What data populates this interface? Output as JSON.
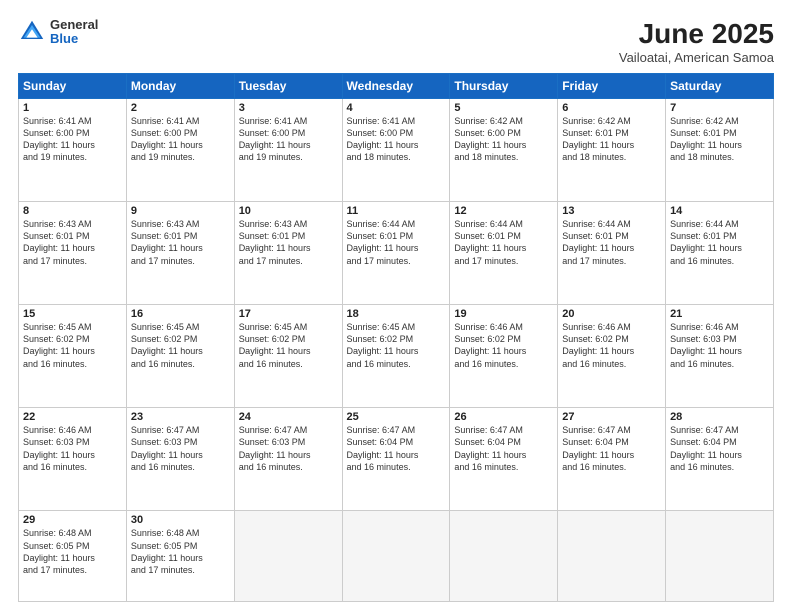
{
  "header": {
    "logo_general": "General",
    "logo_blue": "Blue",
    "month_title": "June 2025",
    "location": "Vailoatai, American Samoa"
  },
  "days_of_week": [
    "Sunday",
    "Monday",
    "Tuesday",
    "Wednesday",
    "Thursday",
    "Friday",
    "Saturday"
  ],
  "weeks": [
    [
      {
        "num": "1",
        "info": "Sunrise: 6:41 AM\nSunset: 6:00 PM\nDaylight: 11 hours\nand 19 minutes."
      },
      {
        "num": "2",
        "info": "Sunrise: 6:41 AM\nSunset: 6:00 PM\nDaylight: 11 hours\nand 19 minutes."
      },
      {
        "num": "3",
        "info": "Sunrise: 6:41 AM\nSunset: 6:00 PM\nDaylight: 11 hours\nand 19 minutes."
      },
      {
        "num": "4",
        "info": "Sunrise: 6:41 AM\nSunset: 6:00 PM\nDaylight: 11 hours\nand 18 minutes."
      },
      {
        "num": "5",
        "info": "Sunrise: 6:42 AM\nSunset: 6:00 PM\nDaylight: 11 hours\nand 18 minutes."
      },
      {
        "num": "6",
        "info": "Sunrise: 6:42 AM\nSunset: 6:01 PM\nDaylight: 11 hours\nand 18 minutes."
      },
      {
        "num": "7",
        "info": "Sunrise: 6:42 AM\nSunset: 6:01 PM\nDaylight: 11 hours\nand 18 minutes."
      }
    ],
    [
      {
        "num": "8",
        "info": "Sunrise: 6:43 AM\nSunset: 6:01 PM\nDaylight: 11 hours\nand 17 minutes."
      },
      {
        "num": "9",
        "info": "Sunrise: 6:43 AM\nSunset: 6:01 PM\nDaylight: 11 hours\nand 17 minutes."
      },
      {
        "num": "10",
        "info": "Sunrise: 6:43 AM\nSunset: 6:01 PM\nDaylight: 11 hours\nand 17 minutes."
      },
      {
        "num": "11",
        "info": "Sunrise: 6:44 AM\nSunset: 6:01 PM\nDaylight: 11 hours\nand 17 minutes."
      },
      {
        "num": "12",
        "info": "Sunrise: 6:44 AM\nSunset: 6:01 PM\nDaylight: 11 hours\nand 17 minutes."
      },
      {
        "num": "13",
        "info": "Sunrise: 6:44 AM\nSunset: 6:01 PM\nDaylight: 11 hours\nand 17 minutes."
      },
      {
        "num": "14",
        "info": "Sunrise: 6:44 AM\nSunset: 6:01 PM\nDaylight: 11 hours\nand 16 minutes."
      }
    ],
    [
      {
        "num": "15",
        "info": "Sunrise: 6:45 AM\nSunset: 6:02 PM\nDaylight: 11 hours\nand 16 minutes."
      },
      {
        "num": "16",
        "info": "Sunrise: 6:45 AM\nSunset: 6:02 PM\nDaylight: 11 hours\nand 16 minutes."
      },
      {
        "num": "17",
        "info": "Sunrise: 6:45 AM\nSunset: 6:02 PM\nDaylight: 11 hours\nand 16 minutes."
      },
      {
        "num": "18",
        "info": "Sunrise: 6:45 AM\nSunset: 6:02 PM\nDaylight: 11 hours\nand 16 minutes."
      },
      {
        "num": "19",
        "info": "Sunrise: 6:46 AM\nSunset: 6:02 PM\nDaylight: 11 hours\nand 16 minutes."
      },
      {
        "num": "20",
        "info": "Sunrise: 6:46 AM\nSunset: 6:02 PM\nDaylight: 11 hours\nand 16 minutes."
      },
      {
        "num": "21",
        "info": "Sunrise: 6:46 AM\nSunset: 6:03 PM\nDaylight: 11 hours\nand 16 minutes."
      }
    ],
    [
      {
        "num": "22",
        "info": "Sunrise: 6:46 AM\nSunset: 6:03 PM\nDaylight: 11 hours\nand 16 minutes."
      },
      {
        "num": "23",
        "info": "Sunrise: 6:47 AM\nSunset: 6:03 PM\nDaylight: 11 hours\nand 16 minutes."
      },
      {
        "num": "24",
        "info": "Sunrise: 6:47 AM\nSunset: 6:03 PM\nDaylight: 11 hours\nand 16 minutes."
      },
      {
        "num": "25",
        "info": "Sunrise: 6:47 AM\nSunset: 6:04 PM\nDaylight: 11 hours\nand 16 minutes."
      },
      {
        "num": "26",
        "info": "Sunrise: 6:47 AM\nSunset: 6:04 PM\nDaylight: 11 hours\nand 16 minutes."
      },
      {
        "num": "27",
        "info": "Sunrise: 6:47 AM\nSunset: 6:04 PM\nDaylight: 11 hours\nand 16 minutes."
      },
      {
        "num": "28",
        "info": "Sunrise: 6:47 AM\nSunset: 6:04 PM\nDaylight: 11 hours\nand 16 minutes."
      }
    ],
    [
      {
        "num": "29",
        "info": "Sunrise: 6:48 AM\nSunset: 6:05 PM\nDaylight: 11 hours\nand 17 minutes."
      },
      {
        "num": "30",
        "info": "Sunrise: 6:48 AM\nSunset: 6:05 PM\nDaylight: 11 hours\nand 17 minutes."
      },
      {
        "num": "",
        "info": ""
      },
      {
        "num": "",
        "info": ""
      },
      {
        "num": "",
        "info": ""
      },
      {
        "num": "",
        "info": ""
      },
      {
        "num": "",
        "info": ""
      }
    ]
  ]
}
